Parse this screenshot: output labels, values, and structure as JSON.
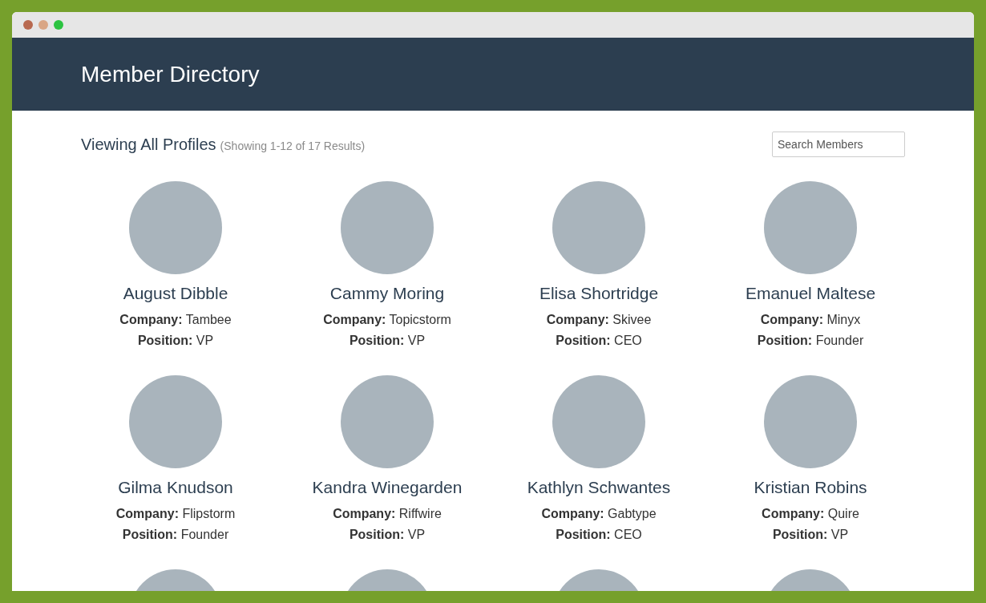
{
  "header": {
    "title": "Member Directory"
  },
  "toolbar": {
    "heading": "Viewing All Profiles",
    "results": "(Showing 1-12 of 17 Results)",
    "search": {
      "placeholder": "Search Members"
    }
  },
  "members": [
    {
      "kind": "profile",
      "name": "August Dibble",
      "company_label": "Company:",
      "company": "Tambee",
      "position_label": "Position:",
      "position": "VP"
    },
    {
      "kind": "profile",
      "name": "Cammy Moring",
      "company_label": "Company:",
      "company": "Topicstorm",
      "position_label": "Position:",
      "position": "VP"
    },
    {
      "kind": "profile",
      "name": "Elisa Shortridge",
      "company_label": "Company:",
      "company": "Skivee",
      "position_label": "Position:",
      "position": "CEO"
    },
    {
      "kind": "profile",
      "name": "Emanuel Maltese",
      "company_label": "Company:",
      "company": "Minyx",
      "position_label": "Position:",
      "position": "Founder"
    },
    {
      "kind": "profile",
      "name": "Gilma Knudson",
      "company_label": "Company:",
      "company": "Flipstorm",
      "position_label": "Position:",
      "position": "Founder"
    },
    {
      "kind": "profile",
      "name": "Kandra Winegarden",
      "company_label": "Company:",
      "company": "Riffwire",
      "position_label": "Position:",
      "position": "VP"
    },
    {
      "kind": "profile",
      "name": "Kathlyn Schwantes",
      "company_label": "Company:",
      "company": "Gabtype",
      "position_label": "Position:",
      "position": "CEO"
    },
    {
      "kind": "profile",
      "name": "Kristian Robins",
      "company_label": "Company:",
      "company": "Quire",
      "position_label": "Position:",
      "position": "VP"
    },
    {
      "kind": "cut_off"
    },
    {
      "kind": "cut_off"
    },
    {
      "kind": "cut_off"
    },
    {
      "kind": "cut_off"
    }
  ]
}
